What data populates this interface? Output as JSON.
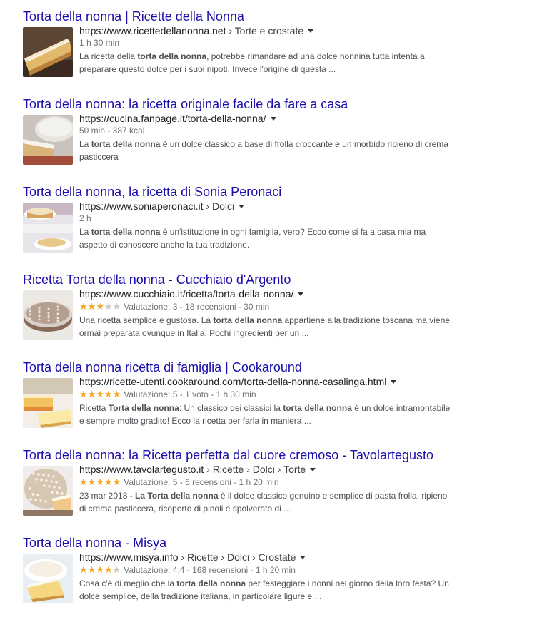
{
  "results": [
    {
      "title": "Torta della nonna | Ricette della Nonna",
      "url": "https://www.ricettedellanonna.net",
      "breadcrumbs": " › Torte e crostate",
      "meta": "1 h 30 min",
      "snippet": [
        {
          "t": "La ricetta della ",
          "b": false
        },
        {
          "t": "torta della nonna",
          "b": true
        },
        {
          "t": ", potrebbe rimandare ad una dolce nonnina tutta intenta a preparare questo dolce per i suoi nipoti. Invece l'origine di questa ...",
          "b": false
        }
      ]
    },
    {
      "title": "Torta della nonna: la ricetta originale facile da fare a casa",
      "url": "https://cucina.fanpage.it/torta-della-nonna/",
      "breadcrumbs": "",
      "meta": "50 min - 387 kcal",
      "snippet": [
        {
          "t": "La ",
          "b": false
        },
        {
          "t": "torta della nonna",
          "b": true
        },
        {
          "t": " è un dolce classico a base di frolla croccante e un morbido ripieno di crema pasticcera",
          "b": false
        }
      ]
    },
    {
      "title": "Torta della nonna, la ricetta di Sonia Peronaci",
      "url": "https://www.soniaperonaci.it",
      "breadcrumbs": " › Dolci",
      "meta": "2 h",
      "snippet": [
        {
          "t": "La ",
          "b": false
        },
        {
          "t": "torta della nonna",
          "b": true
        },
        {
          "t": " è un'istituzione in ogni famiglia, vero? Ecco come si fa a casa mia ma aspetto di conoscere anche la tua tradizione.",
          "b": false
        }
      ]
    },
    {
      "title": "Ricetta Torta della nonna - Cucchiaio d'Argento",
      "url": "https://www.cucchiaio.it/ricetta/torta-della-nonna/",
      "breadcrumbs": "",
      "rating": 3,
      "meta": "Valutazione: 3 - 18 recensioni - 30 min",
      "snippet": [
        {
          "t": "Una ricetta semplice e gustosa. La ",
          "b": false
        },
        {
          "t": "torta della nonna",
          "b": true
        },
        {
          "t": " appartiene alla tradizione toscana ma viene ormai preparata ovunque in Italia. Pochi ingredienti per un ...",
          "b": false
        }
      ]
    },
    {
      "title": "Torta della nonna ricetta di famiglia | Cookaround",
      "url": "https://ricette-utenti.cookaround.com/torta-della-nonna-casalinga.html",
      "breadcrumbs": "",
      "rating": 5,
      "meta": "Valutazione: 5 - 1 voto - 1 h 30 min",
      "snippet": [
        {
          "t": "Ricetta ",
          "b": false
        },
        {
          "t": "Torta della nonna",
          "b": true
        },
        {
          "t": ": Un classico dei classici la ",
          "b": false
        },
        {
          "t": "torta della nonna",
          "b": true
        },
        {
          "t": " è un dolce intramontabile e sempre molto gradito! Ecco la ricetta per farla in maniera ...",
          "b": false
        }
      ]
    },
    {
      "title": "Torta della nonna: la Ricetta perfetta dal cuore cremoso - Tavolartegusto",
      "url": "https://www.tavolartegusto.it",
      "breadcrumbs": " › Ricette › Dolci › Torte",
      "rating": 5,
      "meta": "Valutazione: 5 - 6 recensioni - 1 h 20 min",
      "snippet": [
        {
          "t": "23 mar 2018 - ",
          "b": false
        },
        {
          "t": "La Torta della nonna",
          "b": true
        },
        {
          "t": " è il dolce classico genuino e semplice di pasta frolla, ripieno di crema pasticcera, ricoperto di pinoli e spolverato di ...",
          "b": false
        }
      ]
    },
    {
      "title": "Torta della nonna - Misya",
      "url": "https://www.misya.info",
      "breadcrumbs": " › Ricette › Dolci › Crostate",
      "rating": 4.4,
      "meta": "Valutazione: 4,4 - 168 recensioni - 1 h 20 min",
      "snippet": [
        {
          "t": "Cosa c'è di meglio che la ",
          "b": false
        },
        {
          "t": "torta della nonna",
          "b": true
        },
        {
          "t": " per festeggiare i nonni nel giorno della loro festa? Un dolce semplice, della tradizione italiana, in particolare ligure e ...",
          "b": false
        }
      ]
    }
  ],
  "colors": {
    "title_link": "#1a0dab",
    "star_on": "#f5a623",
    "star_off": "#c9c9c9",
    "snippet_text": "#4d5156",
    "meta_text": "#70757a"
  }
}
